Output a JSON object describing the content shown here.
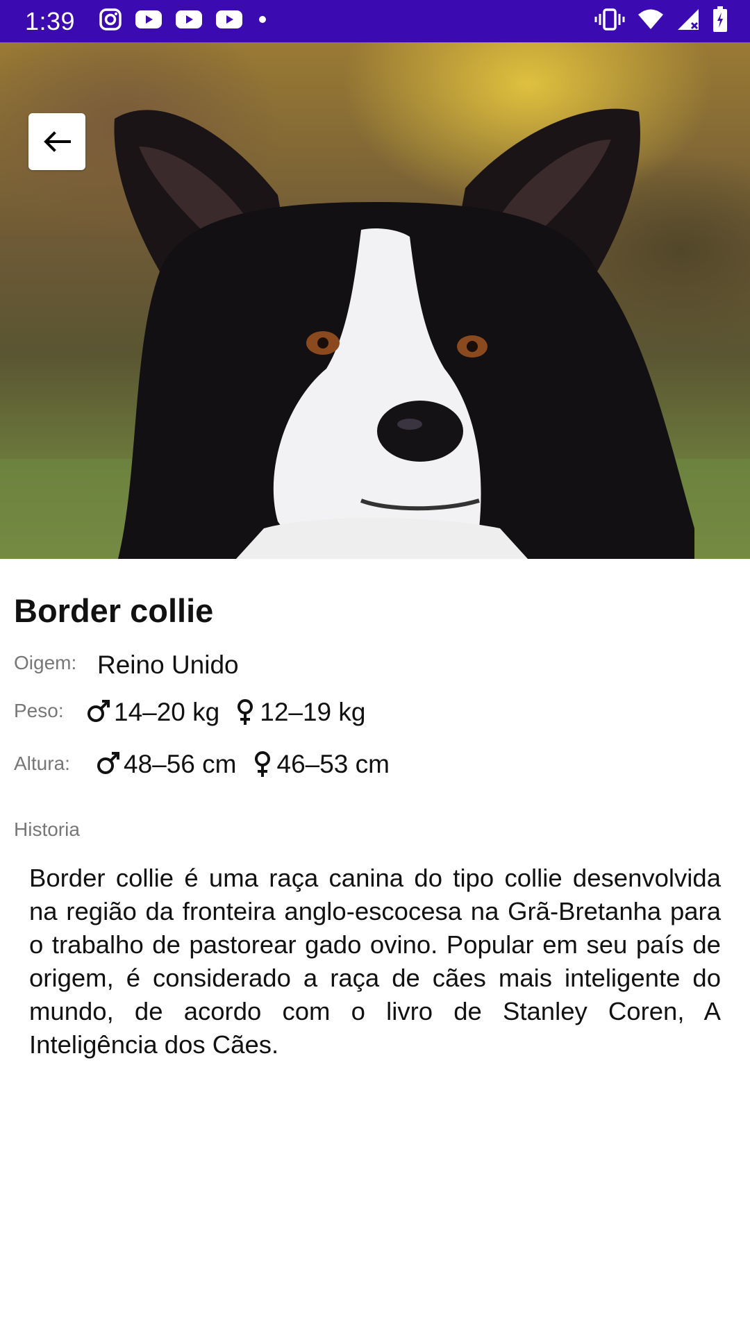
{
  "status_bar": {
    "time": "1:39",
    "left_icons": [
      "instagram-icon",
      "youtube-icon",
      "youtube-icon",
      "youtube-icon",
      "dot-icon"
    ],
    "right_icons": [
      "vibrate-icon",
      "wifi-icon",
      "signal-icon",
      "battery-icon"
    ],
    "background": "#3b0ab0"
  },
  "hero": {
    "image_subject": "black and white border collie dog portrait",
    "back_icon": "arrow-left-icon"
  },
  "breed": {
    "title": "Border collie",
    "origin_label": "Oigem:",
    "origin_value": "Reino Unido",
    "weight_label": "Peso:",
    "weight_male": "14–20 kg",
    "weight_female": "12–19 kg",
    "height_label": "Altura:",
    "height_male": "48–56 cm",
    "height_female": "46–53 cm"
  },
  "history": {
    "label": "Historia",
    "text": "Border collie é uma raça canina do tipo collie desenvolvida na região da fronteira anglo-escocesa na Grã-Bretanha para o trabalho de pastorear gado ovino. Popular em seu país de origem, é considerado a raça de cães mais inteligente do mundo, de acordo com o livro de Stanley Coren, A Inteligência dos Cães."
  }
}
